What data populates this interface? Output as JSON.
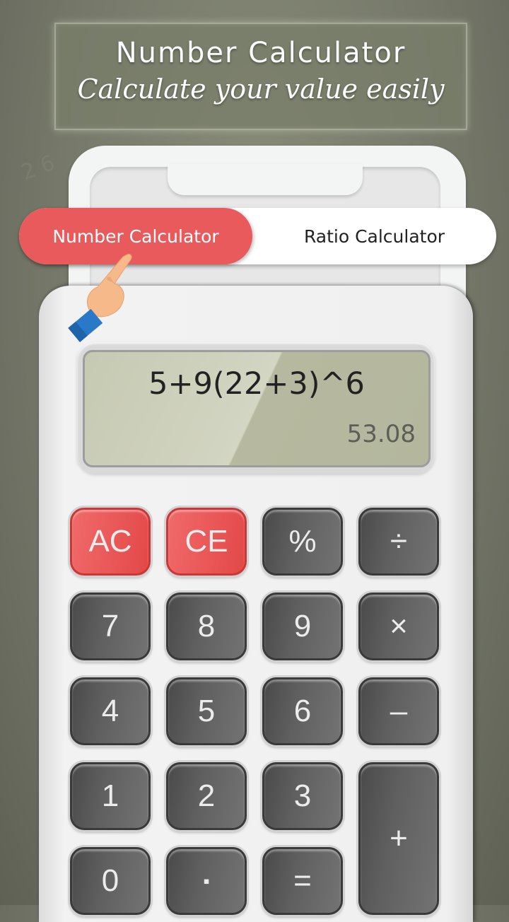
{
  "banner": {
    "title": "Number Calculator",
    "subtitle": "Calculate your value easily"
  },
  "tabs": [
    {
      "label": "Number Calculator",
      "active": true
    },
    {
      "label": "Ratio Calculator",
      "active": false
    }
  ],
  "display": {
    "expression": "5+9(22+3)^6",
    "result": "53.08"
  },
  "keys": {
    "ac": "AC",
    "ce": "CE",
    "percent": "%",
    "divide": "÷",
    "seven": "7",
    "eight": "8",
    "nine": "9",
    "multiply": "×",
    "four": "4",
    "five": "5",
    "six": "6",
    "minus": "–",
    "one": "1",
    "two": "2",
    "three": "3",
    "plus": "+",
    "zero": "0",
    "dot": "▪",
    "equals": "="
  },
  "colors": {
    "accent": "#e95a5c",
    "key_dark": "#5f5f5f",
    "lcd": "#c6c9b2",
    "background": "#76796a"
  }
}
